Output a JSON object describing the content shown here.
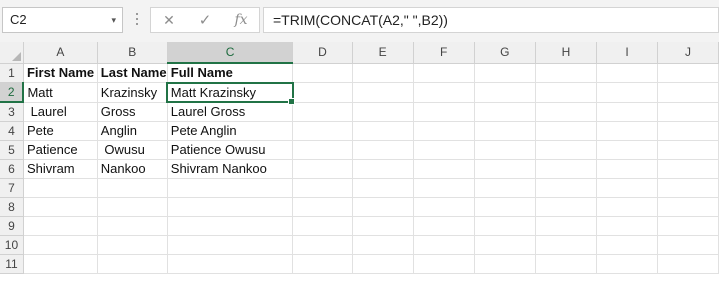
{
  "name_box": {
    "value": "C2",
    "dropdown_glyph": "▾"
  },
  "formula_bar": {
    "cancel_glyph": "✕",
    "enter_glyph": "✓",
    "fx_label": "fx",
    "formula": "=TRIM(CONCAT(A2,\" \",B2))"
  },
  "sheet": {
    "active_cell": "C2",
    "columns": [
      "A",
      "B",
      "C",
      "D",
      "E",
      "F",
      "G",
      "H",
      "I",
      "J"
    ],
    "row_numbers": [
      "1",
      "2",
      "3",
      "4",
      "5",
      "6",
      "7",
      "8",
      "9",
      "10",
      "11"
    ],
    "cells": [
      [
        "First Name",
        "Last Name",
        "Full Name",
        "",
        "",
        "",
        "",
        "",
        "",
        ""
      ],
      [
        "Matt",
        "Krazinsky",
        "Matt Krazinsky",
        "",
        "",
        "",
        "",
        "",
        "",
        ""
      ],
      [
        " Laurel",
        "Gross",
        "Laurel Gross",
        "",
        "",
        "",
        "",
        "",
        "",
        ""
      ],
      [
        "Pete",
        "Anglin",
        "Pete Anglin",
        "",
        "",
        "",
        "",
        "",
        "",
        ""
      ],
      [
        "Patience",
        " Owusu",
        "Patience Owusu",
        "",
        "",
        "",
        "",
        "",
        "",
        ""
      ],
      [
        "Shivram",
        "Nankoo",
        "Shivram Nankoo",
        "",
        "",
        "",
        "",
        "",
        "",
        ""
      ],
      [
        "",
        "",
        "",
        "",
        "",
        "",
        "",
        "",
        "",
        ""
      ],
      [
        "",
        "",
        "",
        "",
        "",
        "",
        "",
        "",
        "",
        ""
      ],
      [
        "",
        "",
        "",
        "",
        "",
        "",
        "",
        "",
        "",
        ""
      ],
      [
        "",
        "",
        "",
        "",
        "",
        "",
        "",
        "",
        "",
        ""
      ],
      [
        "",
        "",
        "",
        "",
        "",
        "",
        "",
        "",
        "",
        ""
      ]
    ]
  },
  "colors": {
    "accent": "#217346",
    "header_bg": "#f0f0f0",
    "gridline": "#e1e1e1"
  }
}
